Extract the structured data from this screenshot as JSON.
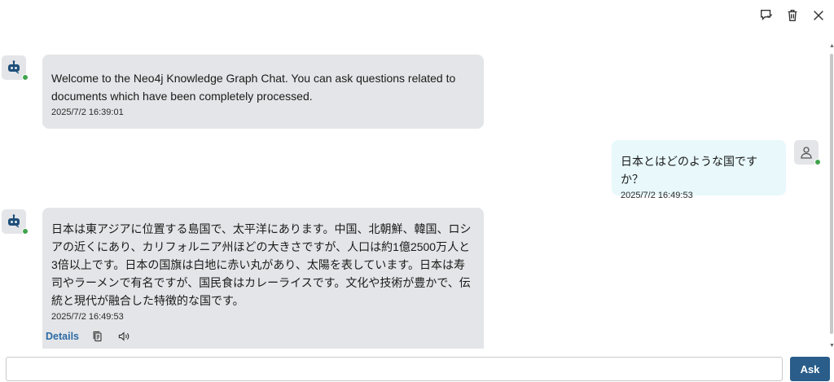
{
  "toolbar": {
    "icons": [
      "comment-bookmark-icon",
      "trash-icon",
      "close-icon"
    ]
  },
  "messages": [
    {
      "role": "bot",
      "text": "Welcome to the Neo4j Knowledge Graph Chat. You can ask questions related to documents which have been completely processed.",
      "time": "2025/7/2 16:39:01",
      "status": "online"
    },
    {
      "role": "user",
      "text": "日本とはどのような国ですか？",
      "time": "2025/7/2 16:49:53",
      "status": "online"
    },
    {
      "role": "bot",
      "text": "日本は東アジアに位置する島国で、太平洋にあります。中国、北朝鮮、韓国、ロシアの近くにあり、カリフォルニア州ほどの大きさですが、人口は約1億2500万人と3倍以上です。日本の国旗は白地に赤い丸があり、太陽を表しています。日本は寿司やラーメンで有名ですが、国民食はカレーライスです。文化や技術が豊かで、伝統と現代が融合した特徴的な国です。",
      "time": "2025/7/2 16:49:53",
      "status": "online",
      "actions": {
        "details_label": "Details",
        "icons": [
          "copy-icon",
          "speaker-icon"
        ]
      }
    }
  ],
  "input": {
    "value": "",
    "placeholder": ""
  },
  "ask_button": {
    "label": "Ask"
  },
  "colors": {
    "bot_bubble": "#e4e5e8",
    "user_bubble": "#e8f8fb",
    "accent": "#2a5d8a",
    "link": "#2d6aa4",
    "online": "#3fa34d"
  }
}
